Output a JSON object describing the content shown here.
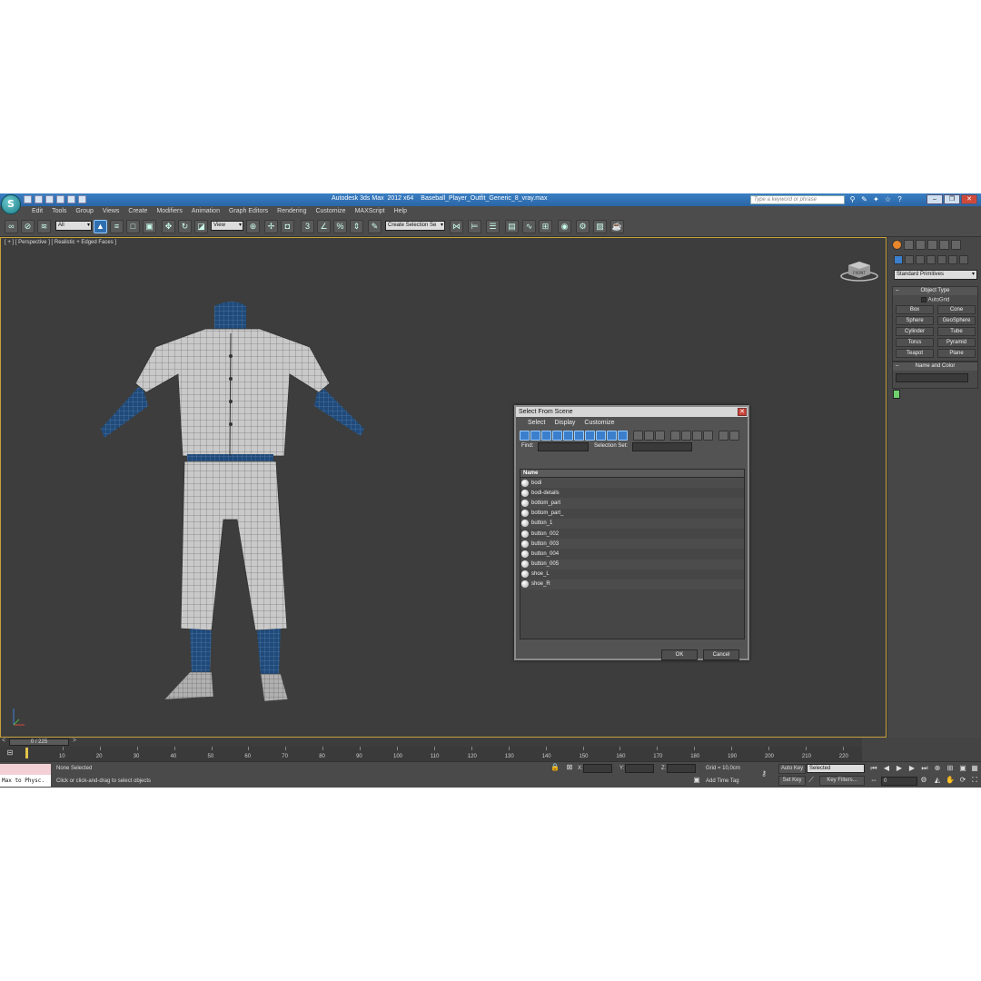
{
  "titlebar": {
    "app_logo": "S",
    "title": "Autodesk 3ds Max  2012 x64",
    "filename": "Baseball_Player_Outfit_Generic_8_vray.max",
    "search_placeholder": "Type a keyword or phrase"
  },
  "menu": [
    "Edit",
    "Tools",
    "Group",
    "Views",
    "Create",
    "Modifiers",
    "Animation",
    "Graph Editors",
    "Rendering",
    "Customize",
    "MAXScript",
    "Help"
  ],
  "toolbar": {
    "filter_value": "All",
    "coord_value": "View",
    "selection_set_value": "Create Selection Se"
  },
  "viewport": {
    "label": "[ + ] [ Perspective ] [ Realistic + Edged Faces ]",
    "viewcube_label": "FRONT"
  },
  "dialog": {
    "title": "Select From Scene",
    "menu": [
      "Select",
      "Display",
      "Customize"
    ],
    "find_label": "Find:",
    "selection_set_label": "Selection Set:",
    "column_name": "Name",
    "objects": [
      "bodi",
      "bodi-details",
      "bottom_part",
      "bottom_part_",
      "button_1",
      "button_002",
      "button_003",
      "button_004",
      "button_005",
      "shoe_L",
      "shoe_R"
    ],
    "ok_label": "OK",
    "cancel_label": "Cancel"
  },
  "command_panel": {
    "category": "Standard Primitives",
    "object_type_title": "Object Type",
    "autogrid_label": "AutoGrid",
    "objects": [
      "Box",
      "Cone",
      "Sphere",
      "GeoSphere",
      "Cylinder",
      "Tube",
      "Torus",
      "Pyramid",
      "Teapot",
      "Plane"
    ],
    "name_color_title": "Name and Color",
    "color": "#6fd06f"
  },
  "timeline": {
    "frame_display": "0 / 225",
    "ticks": [
      "10",
      "20",
      "30",
      "40",
      "50",
      "60",
      "70",
      "80",
      "90",
      "100",
      "110",
      "120",
      "130",
      "140",
      "150",
      "160",
      "170",
      "180",
      "190",
      "200",
      "210",
      "220"
    ]
  },
  "status": {
    "listener": "Max to Physc.",
    "selection": "None Selected",
    "prompt": "Click or click-and-drag to select objects",
    "x_label": "X:",
    "y_label": "Y:",
    "z_label": "Z:",
    "grid": "Grid = 10,0cm",
    "add_time_tag": "Add Time Tag",
    "auto_key": "Auto Key",
    "key_mode": "Selected",
    "set_key": "Set Key",
    "key_filters": "Key Filters...",
    "current_frame": "0"
  }
}
